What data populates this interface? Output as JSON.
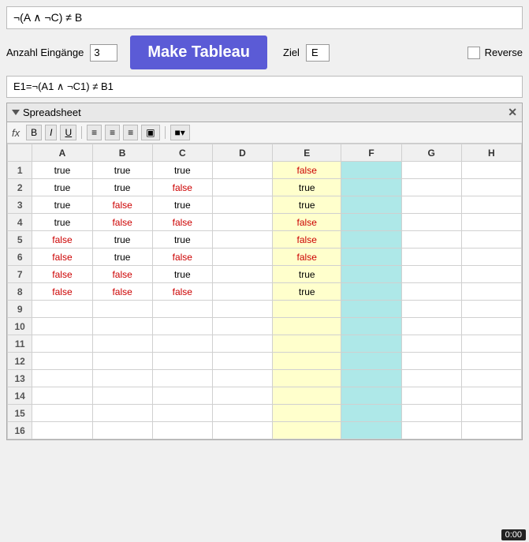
{
  "formula_top": "¬(A ∧ ¬C) ≠ B",
  "controls": {
    "eingaenge_label": "Anzahl Eingänge",
    "eingaenge_value": "3",
    "btn_label": "Make Tableau",
    "ziel_label": "Ziel",
    "ziel_value": "E",
    "reverse_label": "Reverse"
  },
  "formula_second": "E1=¬(A1 ∧ ¬C1) ≠ B1",
  "spreadsheet": {
    "title": "Spreadsheet",
    "columns": [
      "A",
      "B",
      "C",
      "D",
      "E",
      "F",
      "G",
      "H"
    ],
    "rows": [
      {
        "num": 1,
        "A": "true",
        "B": "true",
        "C": "true",
        "D": "",
        "E": "false",
        "F": "",
        "G": "",
        "H": ""
      },
      {
        "num": 2,
        "A": "true",
        "B": "true",
        "C": "false",
        "D": "",
        "E": "true",
        "F": "",
        "G": "",
        "H": ""
      },
      {
        "num": 3,
        "A": "true",
        "B": "false",
        "C": "true",
        "D": "",
        "E": "true",
        "F": "",
        "G": "",
        "H": ""
      },
      {
        "num": 4,
        "A": "true",
        "B": "false",
        "C": "false",
        "D": "",
        "E": "false",
        "F": "",
        "G": "",
        "H": ""
      },
      {
        "num": 5,
        "A": "false",
        "B": "true",
        "C": "true",
        "D": "",
        "E": "false",
        "F": "",
        "G": "",
        "H": ""
      },
      {
        "num": 6,
        "A": "false",
        "B": "true",
        "C": "false",
        "D": "",
        "E": "false",
        "F": "",
        "G": "",
        "H": ""
      },
      {
        "num": 7,
        "A": "false",
        "B": "false",
        "C": "true",
        "D": "",
        "E": "true",
        "F": "",
        "G": "",
        "H": ""
      },
      {
        "num": 8,
        "A": "false",
        "B": "false",
        "C": "false",
        "D": "",
        "E": "true",
        "F": "",
        "G": "",
        "H": ""
      },
      {
        "num": 9,
        "A": "",
        "B": "",
        "C": "",
        "D": "",
        "E": "",
        "F": "",
        "G": "",
        "H": ""
      },
      {
        "num": 10,
        "A": "",
        "B": "",
        "C": "",
        "D": "",
        "E": "",
        "F": "",
        "G": "",
        "H": ""
      },
      {
        "num": 11,
        "A": "",
        "B": "",
        "C": "",
        "D": "",
        "E": "",
        "F": "",
        "G": "",
        "H": ""
      },
      {
        "num": 12,
        "A": "",
        "B": "",
        "C": "",
        "D": "",
        "E": "",
        "F": "",
        "G": "",
        "H": ""
      },
      {
        "num": 13,
        "A": "",
        "B": "",
        "C": "",
        "D": "",
        "E": "",
        "F": "",
        "G": "",
        "H": ""
      },
      {
        "num": 14,
        "A": "",
        "B": "",
        "C": "",
        "D": "",
        "E": "",
        "F": "",
        "G": "",
        "H": ""
      },
      {
        "num": 15,
        "A": "",
        "B": "",
        "C": "",
        "D": "",
        "E": "",
        "F": "",
        "G": "",
        "H": ""
      },
      {
        "num": 16,
        "A": "",
        "B": "",
        "C": "",
        "D": "",
        "E": "",
        "F": "",
        "G": "",
        "H": ""
      }
    ]
  },
  "toolbar": {
    "bold": "B",
    "italic": "I",
    "underline": "U"
  },
  "time": "0:00"
}
